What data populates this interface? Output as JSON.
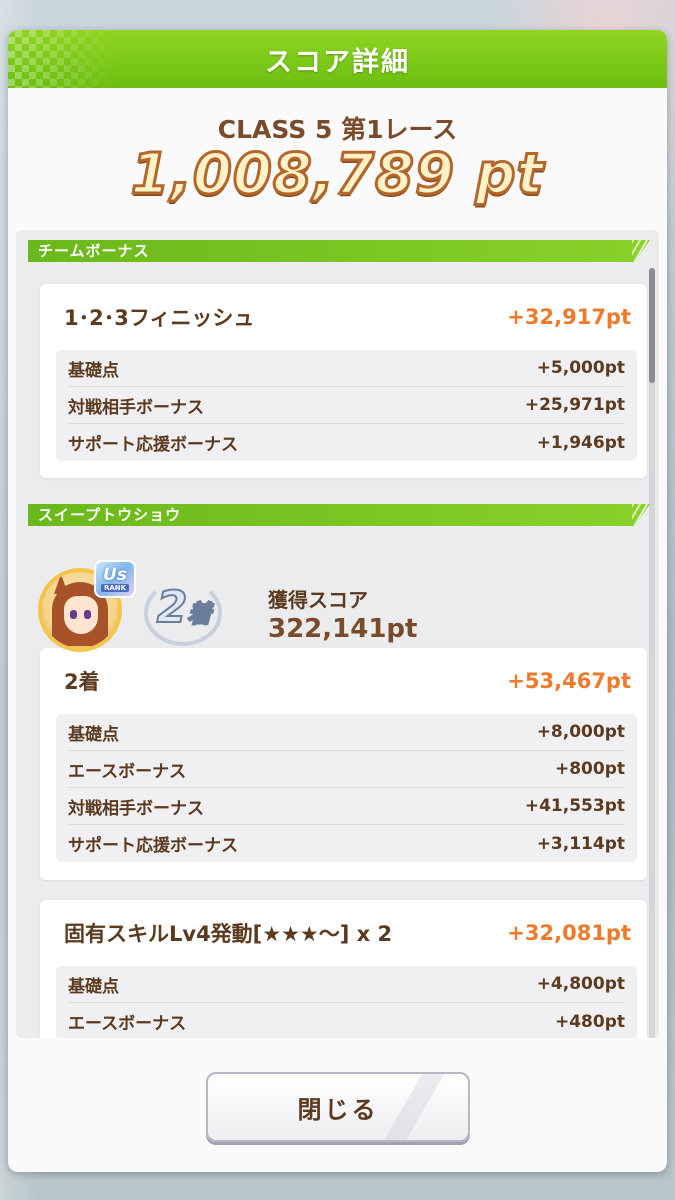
{
  "header": {
    "title": "スコア詳細"
  },
  "race": {
    "name": "CLASS 5 第1レース",
    "total": "1,008,789 pt"
  },
  "team_bonus": {
    "section_label": "チームボーナス",
    "card": {
      "title": "1･2･3フィニッシュ",
      "value": "+32,917pt",
      "rows": [
        {
          "label": "基礎点",
          "value": "+5,000pt"
        },
        {
          "label": "対戦相手ボーナス",
          "value": "+25,971pt"
        },
        {
          "label": "サポート応援ボーナス",
          "value": "+1,946pt"
        }
      ]
    }
  },
  "horse": {
    "section_label": "スイープトウショウ",
    "rank_badge": {
      "main": "Us",
      "sub": "RANK"
    },
    "place": {
      "number": "2",
      "suffix": "着"
    },
    "acquired_label": "獲得スコア",
    "acquired_score": "322,141pt",
    "placement_card": {
      "title": "2着",
      "value": "+53,467pt",
      "rows": [
        {
          "label": "基礎点",
          "value": "+8,000pt"
        },
        {
          "label": "エースボーナス",
          "value": "+800pt"
        },
        {
          "label": "対戦相手ボーナス",
          "value": "+41,553pt"
        },
        {
          "label": "サポート応援ボーナス",
          "value": "+3,114pt"
        }
      ]
    },
    "skill_card": {
      "title": "固有スキルLv4発動[★★★～] x 2",
      "value": "+32,081pt",
      "rows": [
        {
          "label": "基礎点",
          "value": "+4,800pt"
        },
        {
          "label": "エースボーナス",
          "value": "+480pt"
        }
      ]
    }
  },
  "footer": {
    "close_label": "閉じる"
  },
  "colors": {
    "accent_green": "#7cc81a",
    "score_orange": "#f07a2c",
    "text_brown": "#5b3a1f"
  }
}
